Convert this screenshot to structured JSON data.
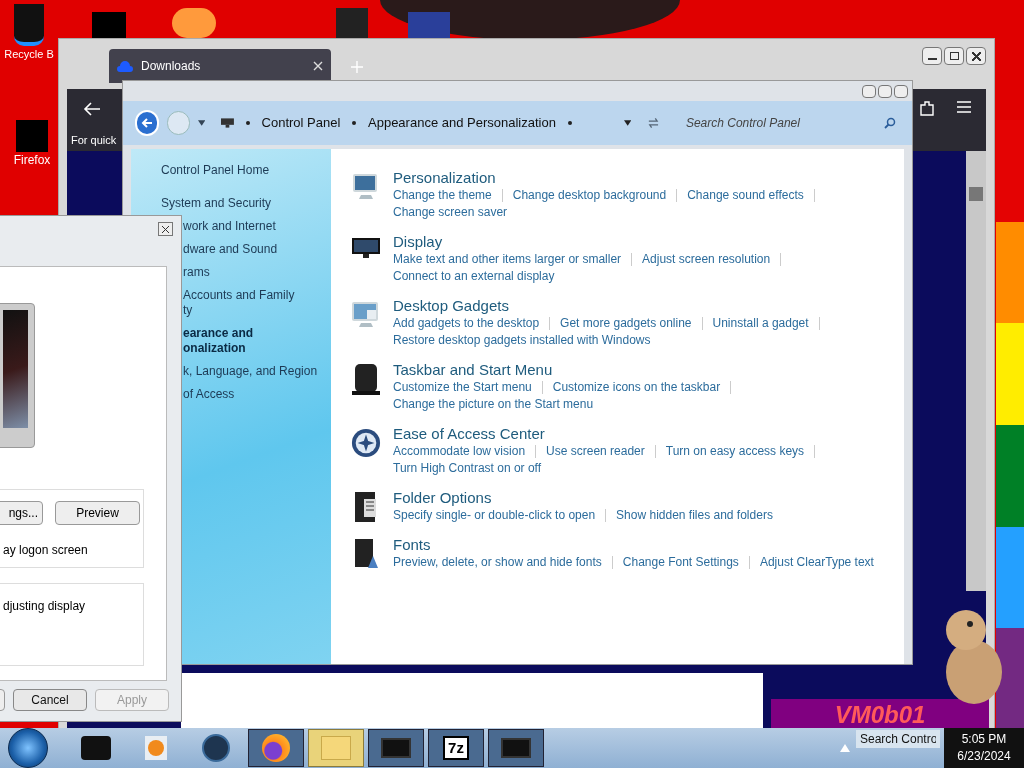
{
  "desktop_icons": [
    {
      "label": "Recycle B"
    },
    {
      "label": "Firefox"
    }
  ],
  "browser": {
    "tab": {
      "label": "Downloads",
      "selected": true
    },
    "hint": "For quick",
    "banner": "VM0b01"
  },
  "control_panel": {
    "breadcrumb": [
      "Control Panel",
      "Appearance and Personalization"
    ],
    "search": {
      "placeholder": "Search Control Panel"
    },
    "sidebar": [
      {
        "lines": [
          "Control Panel Home"
        ],
        "kind": "home",
        "selected": false
      },
      {
        "lines": [
          "System and Security"
        ],
        "kind": "full",
        "selected": false
      },
      {
        "lines": [
          "work and Internet"
        ],
        "kind": "partial",
        "selected": false
      },
      {
        "lines": [
          "dware and Sound"
        ],
        "kind": "partial",
        "selected": false
      },
      {
        "lines": [
          "rams"
        ],
        "kind": "partial",
        "selected": false
      },
      {
        "lines": [
          "Accounts and Family",
          "ty"
        ],
        "kind": "partial",
        "selected": false
      },
      {
        "lines": [
          "earance and",
          "onalization"
        ],
        "kind": "partial",
        "selected": true
      },
      {
        "lines": [
          "k, Language, and Region"
        ],
        "kind": "partial",
        "selected": false
      },
      {
        "lines": [
          "of Access"
        ],
        "kind": "partial",
        "selected": false
      }
    ],
    "categories": [
      {
        "kind": "personalization",
        "title": "Personalization",
        "link_rows": [
          [
            "Change the theme",
            "Change desktop background",
            "Change sound effects"
          ],
          [
            "Change screen saver"
          ]
        ]
      },
      {
        "kind": "display",
        "title": "Display",
        "link_rows": [
          [
            "Make text and other items larger or smaller",
            "Adjust screen resolution"
          ],
          [
            "Connect to an external display"
          ]
        ]
      },
      {
        "kind": "gadgets",
        "title": "Desktop Gadgets",
        "link_rows": [
          [
            "Add gadgets to the desktop",
            "Get more gadgets online",
            "Uninstall a gadget"
          ],
          [
            "Restore desktop gadgets installed with Windows"
          ]
        ]
      },
      {
        "kind": "taskbar",
        "title": "Taskbar and Start Menu",
        "link_rows": [
          [
            "Customize the Start menu",
            "Customize icons on the taskbar"
          ],
          [
            "Change the picture on the Start menu"
          ]
        ]
      },
      {
        "kind": "ease",
        "title": "Ease of Access Center",
        "link_rows": [
          [
            "Accommodate low vision",
            "Use screen reader",
            "Turn on easy access keys"
          ],
          [
            "Turn High Contrast on or off"
          ]
        ]
      },
      {
        "kind": "folder",
        "title": "Folder Options",
        "link_rows": [
          [
            "Specify single- or double-click to open",
            "Show hidden files and folders"
          ]
        ]
      },
      {
        "kind": "fonts",
        "title": "Fonts",
        "link_rows": [
          [
            "Preview, delete, or show and hide fonts",
            "Change Font Settings",
            "Adjust ClearType text"
          ]
        ]
      }
    ]
  },
  "dialog": {
    "settings_button": "ngs...",
    "preview_button": "Preview",
    "logon_text": "ay logon screen",
    "power_text": "djusting display",
    "buttons": [
      {
        "label": "Cancel",
        "disabled": false
      },
      {
        "label": "Apply",
        "disabled": true
      }
    ]
  },
  "taskbar": {
    "apps": [
      {
        "kind": "box",
        "active": false
      },
      {
        "kind": "media",
        "active": false
      },
      {
        "kind": "globe",
        "active": false
      },
      {
        "kind": "firefox",
        "active": false
      },
      {
        "kind": "explorer",
        "active": true
      },
      {
        "kind": "monitor",
        "active": false
      },
      {
        "kind": "zip",
        "label": "7z",
        "active": false
      },
      {
        "kind": "monitor",
        "active": false
      }
    ],
    "search": {
      "placeholder": "Search Contro"
    },
    "time": "5:05 PM",
    "date": "6/23/2024"
  }
}
